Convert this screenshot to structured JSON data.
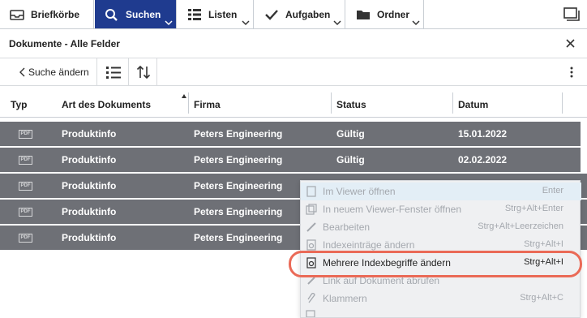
{
  "nav": {
    "items": [
      {
        "label": "Briefkörbe",
        "icon": "inbox-icon",
        "active": false
      },
      {
        "label": "Suchen",
        "icon": "search-icon",
        "active": true
      },
      {
        "label": "Listen",
        "icon": "list-icon",
        "active": false
      },
      {
        "label": "Aufgaben",
        "icon": "check-icon",
        "active": false
      },
      {
        "label": "Ordner",
        "icon": "folder-icon",
        "active": false
      }
    ],
    "accent": "#1f3b8f"
  },
  "header": {
    "title": "Dokumente - Alle Felder"
  },
  "toolbar": {
    "back_label": "Suche ändern"
  },
  "table": {
    "columns": [
      "Typ",
      "Art des Dokuments",
      "Firma",
      "Status",
      "Datum"
    ],
    "rows": [
      {
        "typ": "PDF",
        "art": "Produktinfo",
        "firma": "Peters Engineering",
        "status": "Gültig",
        "datum": "15.01.2022"
      },
      {
        "typ": "PDF",
        "art": "Produktinfo",
        "firma": "Peters Engineering",
        "status": "Gültig",
        "datum": "02.02.2022"
      },
      {
        "typ": "PDF",
        "art": "Produktinfo",
        "firma": "Peters Engineering",
        "status": "",
        "datum": ""
      },
      {
        "typ": "PDF",
        "art": "Produktinfo",
        "firma": "Peters Engineering",
        "status": "",
        "datum": ""
      },
      {
        "typ": "PDF",
        "art": "Produktinfo",
        "firma": "Peters Engineering",
        "status": "",
        "datum": ""
      }
    ],
    "selected_color": "#6e7076"
  },
  "context_menu": {
    "items": [
      {
        "label": "Im Viewer öffnen",
        "shortcut": "Enter",
        "icon": "viewer-icon"
      },
      {
        "label": "In neuem Viewer-Fenster öffnen",
        "shortcut": "Strg+Alt+Enter",
        "icon": "new-window-icon"
      },
      {
        "label": "Bearbeiten",
        "shortcut": "Strg+Alt+Leerzeichen",
        "icon": "pencil-icon"
      },
      {
        "label": "Indexeinträge ändern",
        "shortcut": "Strg+Alt+I",
        "icon": "index-edit-icon"
      },
      {
        "label": "Mehrere Indexbegriffe ändern",
        "shortcut": "Strg+Alt+I",
        "icon": "multi-index-icon"
      },
      {
        "label": "Link auf Dokument abrufen",
        "shortcut": "",
        "icon": "link-icon"
      },
      {
        "label": "Klammern",
        "shortcut": "Strg+Alt+C",
        "icon": "paperclip-icon"
      }
    ],
    "highlight_color": "#ea6a57"
  }
}
